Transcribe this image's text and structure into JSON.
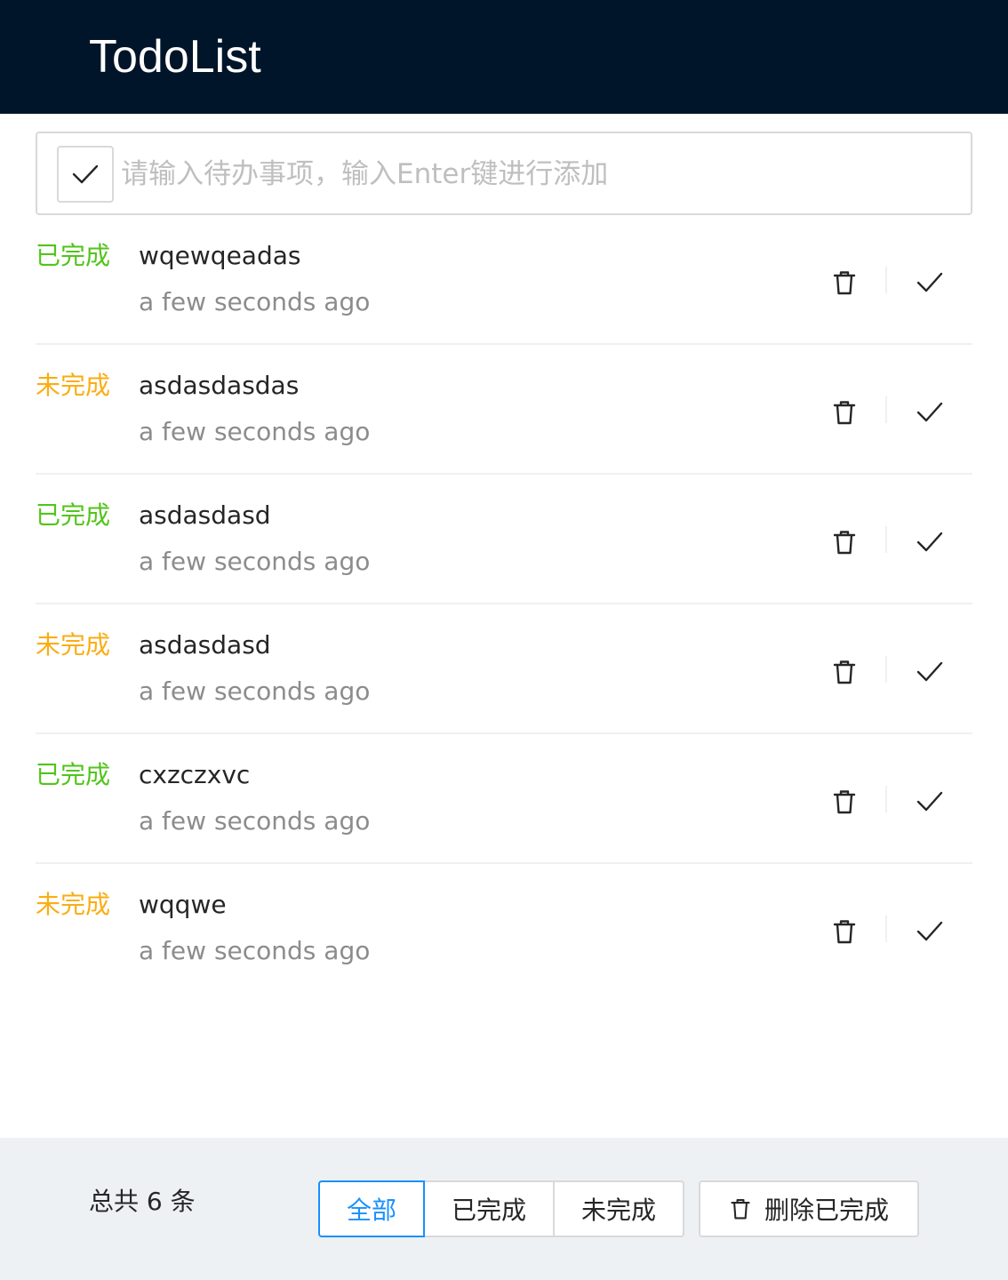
{
  "header": {
    "title": "TodoList"
  },
  "input": {
    "placeholder": "请输入待办事项，输入Enter键进行添加",
    "value": "",
    "toggle_icon": "check-icon"
  },
  "todos": [
    {
      "status": "已完成",
      "state": "done",
      "title": "wqewqeadas",
      "time": "a few seconds ago"
    },
    {
      "status": "未完成",
      "state": "todo",
      "title": "asdasdasdas",
      "time": "a few seconds ago"
    },
    {
      "status": "已完成",
      "state": "done",
      "title": "asdasdasd",
      "time": "a few seconds ago"
    },
    {
      "status": "未完成",
      "state": "todo",
      "title": "asdasdasd",
      "time": "a few seconds ago"
    },
    {
      "status": "已完成",
      "state": "done",
      "title": "cxzczxvc",
      "time": "a few seconds ago"
    },
    {
      "status": "未完成",
      "state": "todo",
      "title": "wqqwe",
      "time": "a few seconds ago"
    }
  ],
  "item_actions": {
    "delete_icon": "trash-icon",
    "complete_icon": "check-icon"
  },
  "footer": {
    "total_label": "总共 6 条",
    "filters": [
      {
        "label": "全部",
        "active": true
      },
      {
        "label": "已完成",
        "active": false
      },
      {
        "label": "未完成",
        "active": false
      }
    ],
    "clear_label": "删除已完成",
    "clear_icon": "trash-icon"
  },
  "colors": {
    "header_bg": "#001529",
    "done": "#52c41a",
    "todo": "#faad14",
    "accent": "#1890ff",
    "footer_bg": "#eef1f4"
  }
}
